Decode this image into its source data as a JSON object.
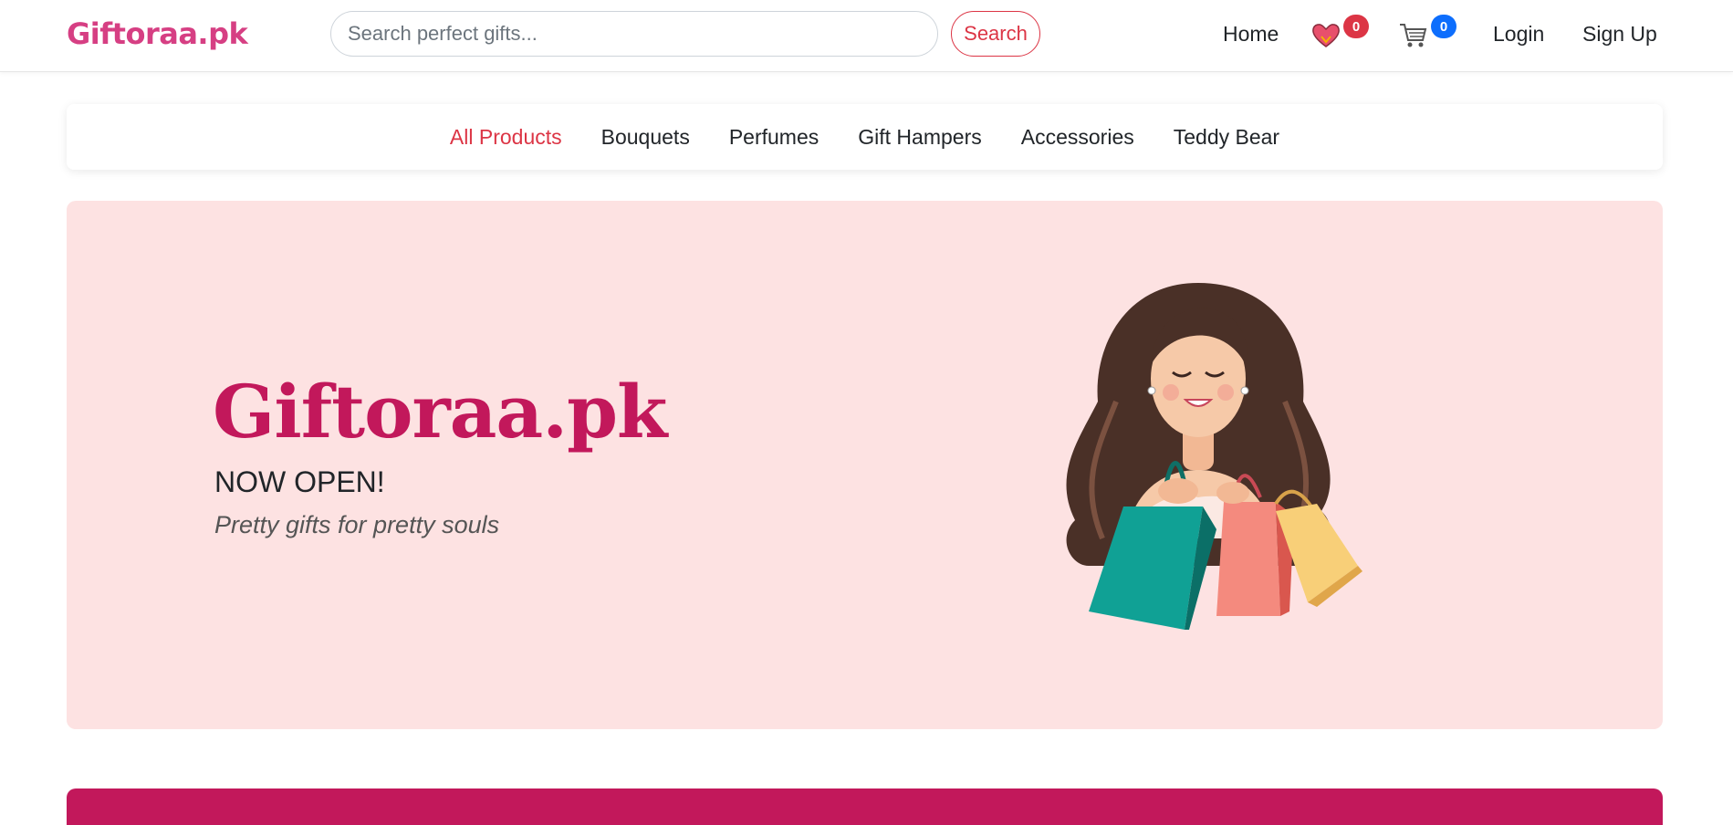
{
  "header": {
    "brand": "Giftoraa.pk",
    "search": {
      "placeholder": "Search perfect gifts...",
      "value": "",
      "button_label": "Search"
    },
    "nav": {
      "home": "Home",
      "login": "Login",
      "signup": "Sign Up"
    },
    "wishlist_count": "0",
    "cart_count": "0"
  },
  "categories": {
    "items": [
      "All Products",
      "Bouquets",
      "Perfumes",
      "Gift Hampers",
      "Accessories",
      "Teddy Bear"
    ],
    "active": "All Products"
  },
  "hero": {
    "title": "Giftoraa.pk",
    "subtitle": "NOW OPEN!",
    "tagline": "Pretty gifts for pretty souls"
  },
  "colors": {
    "brand": "#d63f83",
    "accent": "#dc3545",
    "hero_bg": "#fde2e2",
    "hero_title": "#c2185b",
    "cart_badge": "#0d6efd"
  },
  "icons": [
    "heart-icon",
    "cart-icon",
    "shopping-woman-illustration"
  ]
}
